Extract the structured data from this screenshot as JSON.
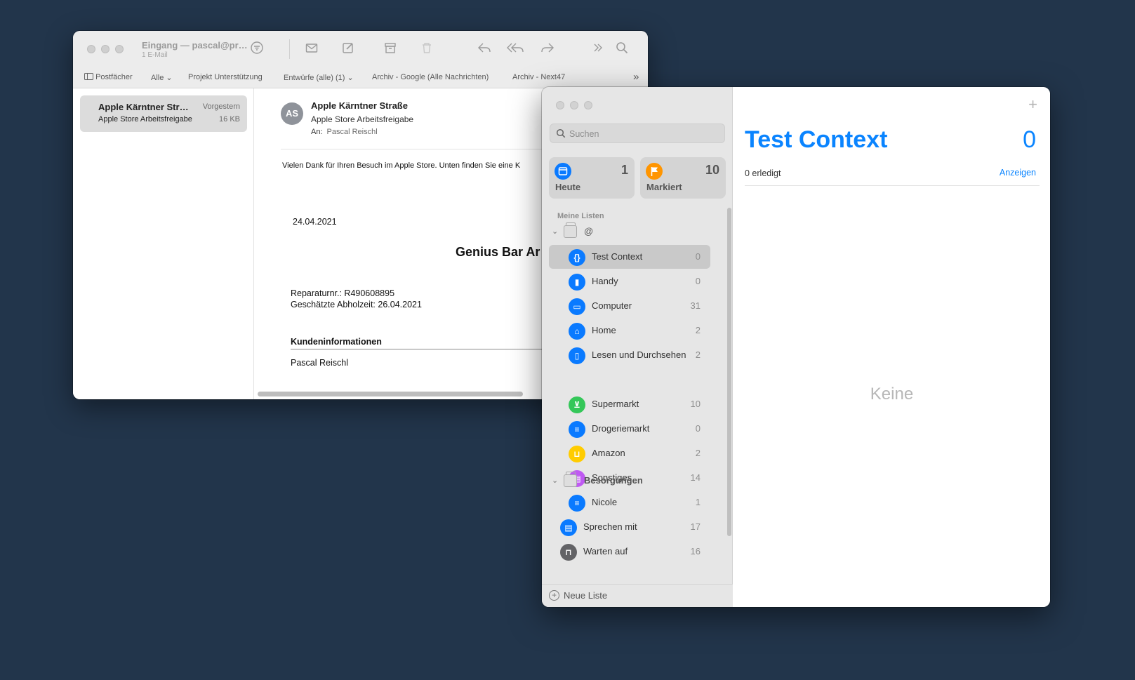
{
  "mail": {
    "window_title": "Eingang — pascal@pr…",
    "window_subtitle": "1 E-Mail",
    "favorites": {
      "postfaecher": "Postfächer",
      "alle": "Alle",
      "projekt": "Projekt Unterstützung",
      "entwuerfe": "Entwürfe (alle) (1)",
      "archiv_google": "Archiv - Google (Alle Nachrichten)",
      "archiv_next47": "Archiv - Next47"
    },
    "list": [
      {
        "from": "Apple Kärntner Str…",
        "date": "Vorgestern",
        "subject": "Apple Store Arbeitsfreigabe",
        "size": "16 KB"
      }
    ],
    "message": {
      "avatar": "AS",
      "from": "Apple Kärntner Straße",
      "subject": "Apple Store Arbeitsfreigabe",
      "to_label": "An:",
      "to": "Pascal Reischl",
      "intro": "Vielen Dank für Ihren Besuch im Apple Store. Unten finden Sie eine K",
      "date": "24.04.2021",
      "heading": "Genius Bar Ar",
      "repair_no": "Reparaturnr.: R490608895",
      "pickup": "Geschätzte Abholzeit: 26.04.2021",
      "customer_heading": "Kundeninformationen",
      "customer_name": "Pascal Reischl"
    }
  },
  "reminders": {
    "search_placeholder": "Suchen",
    "smart_lists": [
      {
        "label": "Heute",
        "count": "1",
        "color": "#0a7aff",
        "icon": "calendar-icon"
      },
      {
        "label": "Markiert",
        "count": "10",
        "color": "#ff9500",
        "icon": "flag-icon"
      }
    ],
    "my_lists_label": "Meine Listen",
    "groups": [
      {
        "label": "@"
      },
      {
        "label": "Besorgungen"
      }
    ],
    "lists": [
      {
        "label": "Test Context",
        "count": "0",
        "color": "#0a7aff",
        "glyph": "{}"
      },
      {
        "label": "Handy",
        "count": "0",
        "color": "#0a7aff",
        "glyph": "▮"
      },
      {
        "label": "Computer",
        "count": "31",
        "color": "#0a7aff",
        "glyph": "▭"
      },
      {
        "label": "Home",
        "count": "2",
        "color": "#0a7aff",
        "glyph": "⌂"
      },
      {
        "label": "Lesen und Durchsehen",
        "count": "2",
        "color": "#0a7aff",
        "glyph": "▯"
      },
      {
        "label": "Supermarkt",
        "count": "10",
        "color": "#34c759",
        "glyph": "⊻"
      },
      {
        "label": "Drogeriemarkt",
        "count": "0",
        "color": "#0a7aff",
        "glyph": "≡"
      },
      {
        "label": "Amazon",
        "count": "2",
        "color": "#ffcc00",
        "glyph": "⊔"
      },
      {
        "label": "Sonstiges",
        "count": "14",
        "color": "#bf5af2",
        "glyph": "▤"
      },
      {
        "label": "Nicole",
        "count": "1",
        "color": "#0a7aff",
        "glyph": "≡"
      },
      {
        "label": "Sprechen mit",
        "count": "17",
        "color": "#0a7aff",
        "glyph": "▤"
      },
      {
        "label": "Warten auf",
        "count": "16",
        "color": "#636366",
        "glyph": "⊓"
      }
    ],
    "new_list": "Neue Liste",
    "main": {
      "title": "Test Context",
      "count": "0",
      "done": "0 erledigt",
      "show": "Anzeigen",
      "empty": "Keine"
    }
  }
}
